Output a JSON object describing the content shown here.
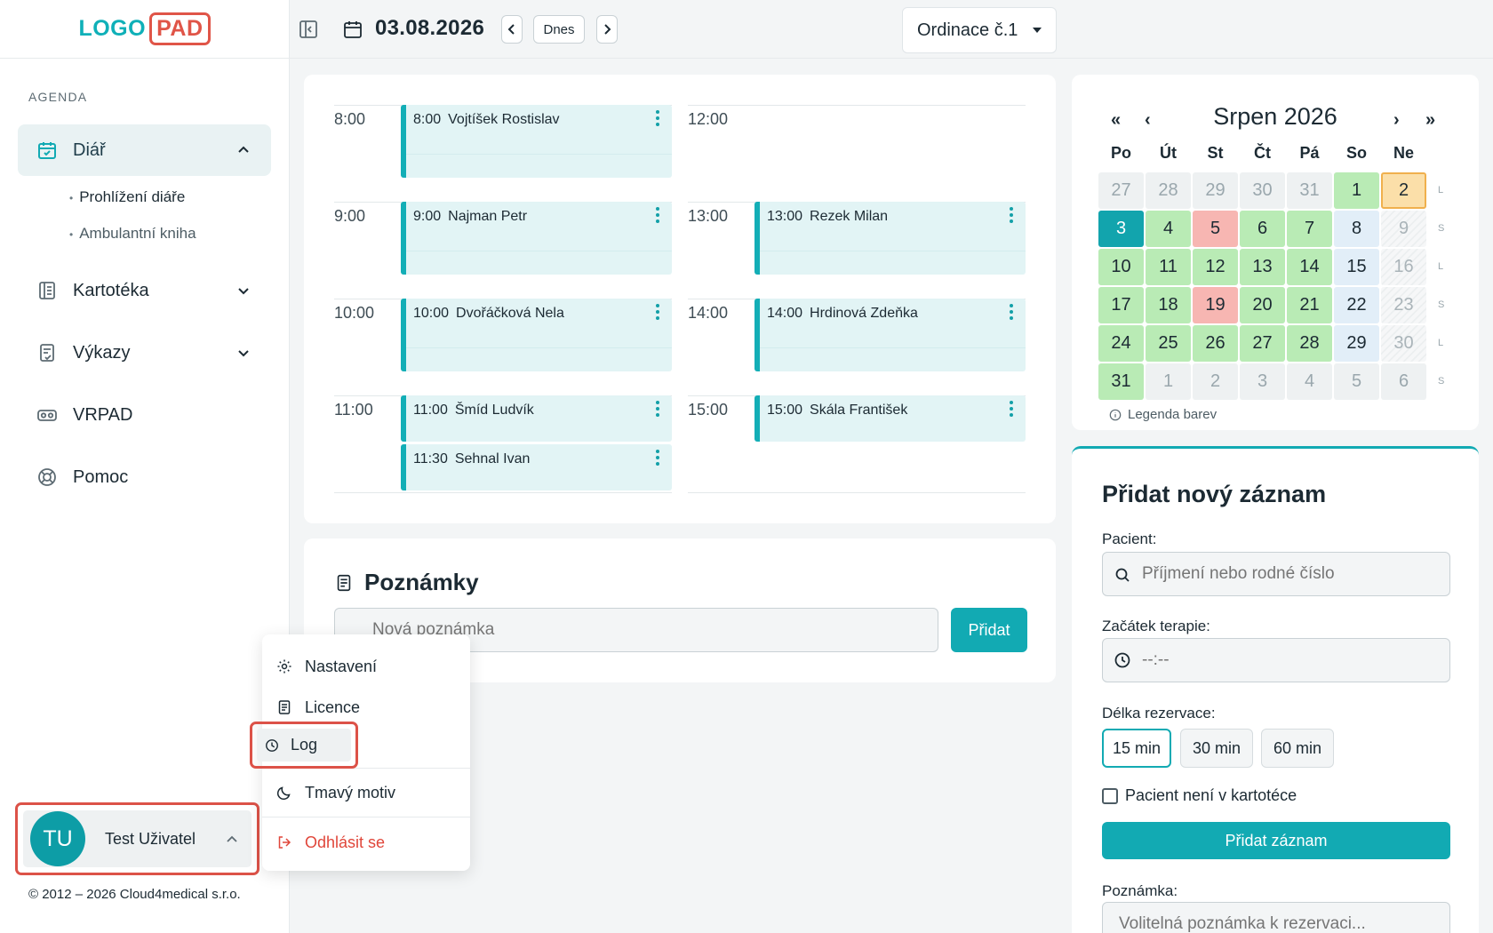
{
  "logo": {
    "part1": "LOGO",
    "part2": "PAD"
  },
  "sidebar": {
    "section": "AGENDA",
    "diar": {
      "label": "Diář",
      "sub": [
        "Prohlížení diáře",
        "Ambulantní kniha"
      ]
    },
    "items": [
      {
        "label": "Kartotéka"
      },
      {
        "label": "Výkazy"
      },
      {
        "label": "VRPAD"
      },
      {
        "label": "Pomoc"
      }
    ],
    "user": {
      "initials": "TU",
      "name": "Test Uživatel"
    },
    "copyright": "© 2012 – 2026 Cloud4medical s.r.o."
  },
  "user_menu": {
    "settings": "Nastavení",
    "license": "Licence",
    "log": "Log",
    "dark": "Tmavý motiv",
    "logout": "Odhlásit se"
  },
  "topbar": {
    "date": "03.08.2026",
    "today": "Dnes",
    "office": "Ordinace č.1"
  },
  "schedule": {
    "left_hours": [
      "8:00",
      "9:00",
      "10:00",
      "11:00"
    ],
    "right_hours": [
      "12:00",
      "13:00",
      "14:00",
      "15:00"
    ],
    "appointments": [
      {
        "time": "8:00",
        "name": "Vojtíšek Rostislav"
      },
      {
        "time": "9:00",
        "name": "Najman Petr"
      },
      {
        "time": "10:00",
        "name": "Dvořáčková Nela"
      },
      {
        "time": "11:00",
        "name": "Šmíd Ludvík"
      },
      {
        "time": "11:30",
        "name": "Sehnal Ivan"
      },
      {
        "time": "13:00",
        "name": "Rezek Milan"
      },
      {
        "time": "14:00",
        "name": "Hrdinová Zdeňka"
      },
      {
        "time": "15:00",
        "name": "Skála František"
      }
    ]
  },
  "notes": {
    "title": "Poznámky",
    "placeholder": "Nová poznámka",
    "button": "Přidat"
  },
  "calendar": {
    "nav": {
      "prev_year": "«",
      "prev": "‹",
      "next": "›",
      "next_year": "»"
    },
    "title": "Srpen 2026",
    "dow": [
      "Po",
      "Út",
      "St",
      "Čt",
      "Pá",
      "So",
      "Ne"
    ],
    "weeks": [
      [
        [
          "27",
          "out"
        ],
        [
          "28",
          "out"
        ],
        [
          "29",
          "out"
        ],
        [
          "30",
          "out"
        ],
        [
          "31",
          "out"
        ],
        [
          "1",
          "green"
        ],
        [
          "2",
          "orange"
        ]
      ],
      [
        [
          "3",
          "teal"
        ],
        [
          "4",
          "green"
        ],
        [
          "5",
          "red"
        ],
        [
          "6",
          "green"
        ],
        [
          "7",
          "green"
        ],
        [
          "8",
          "blue"
        ],
        [
          "9",
          "hatch"
        ]
      ],
      [
        [
          "10",
          "green"
        ],
        [
          "11",
          "green"
        ],
        [
          "12",
          "green"
        ],
        [
          "13",
          "green"
        ],
        [
          "14",
          "green"
        ],
        [
          "15",
          "blue"
        ],
        [
          "16",
          "hatch"
        ]
      ],
      [
        [
          "17",
          "green"
        ],
        [
          "18",
          "green"
        ],
        [
          "19",
          "red"
        ],
        [
          "20",
          "green"
        ],
        [
          "21",
          "green"
        ],
        [
          "22",
          "blue"
        ],
        [
          "23",
          "hatch"
        ]
      ],
      [
        [
          "24",
          "green"
        ],
        [
          "25",
          "green"
        ],
        [
          "26",
          "green"
        ],
        [
          "27",
          "green"
        ],
        [
          "28",
          "green"
        ],
        [
          "29",
          "blue"
        ],
        [
          "30",
          "hatch"
        ]
      ],
      [
        [
          "31",
          "green"
        ],
        [
          "1",
          "out"
        ],
        [
          "2",
          "out"
        ],
        [
          "3",
          "out"
        ],
        [
          "4",
          "out"
        ],
        [
          "5",
          "out"
        ],
        [
          "6",
          "out"
        ]
      ]
    ],
    "week_marks": [
      "L",
      "S",
      "L",
      "S",
      "L",
      "S"
    ],
    "legend": "Legenda barev",
    "colors": {
      "green": "#b9ebb5",
      "red": "#f7b6b2",
      "teal": "#12a4ad",
      "blue": "#e2eef8",
      "orange": "#fbdfa9"
    }
  },
  "form": {
    "title": "Přidat nový záznam",
    "patient_label": "Pacient:",
    "patient_placeholder": "Příjmení nebo rodné číslo",
    "start_label": "Začátek terapie:",
    "start_placeholder": "--:--",
    "length_label": "Délka rezervace:",
    "lengths": [
      "15 min",
      "30 min",
      "60 min"
    ],
    "not_in_registry": "Pacient není v kartotéce",
    "add_button": "Přidat záznam",
    "note_label": "Poznámka:",
    "note_placeholder": "Volitelná poznámka k rezervaci..."
  },
  "accent": "#12aab3",
  "highlight": "#dc5248"
}
